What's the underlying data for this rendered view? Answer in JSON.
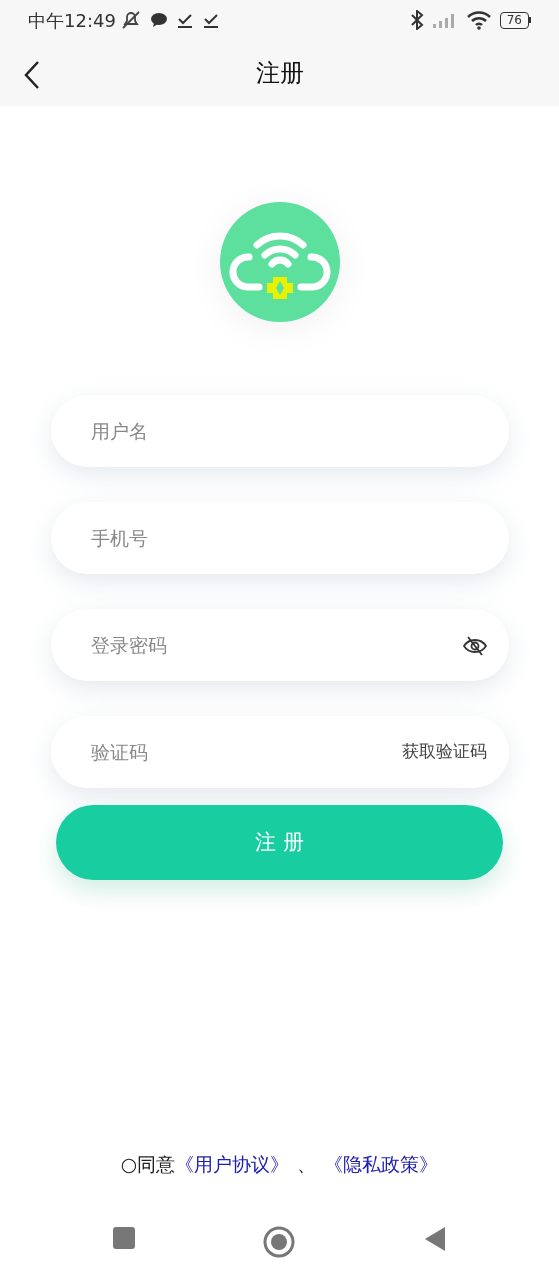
{
  "status_bar": {
    "time": "中午12:49",
    "battery": "76"
  },
  "header": {
    "title": "注册"
  },
  "fields": [
    {
      "kind": "text",
      "placeholder": "用户名"
    },
    {
      "kind": "text",
      "placeholder": "手机号"
    },
    {
      "kind": "password",
      "placeholder": "登录密码"
    },
    {
      "kind": "code",
      "placeholder": "验证码",
      "action": "获取验证码"
    }
  ],
  "submit": {
    "label": "注 册"
  },
  "agreement": {
    "prefix": "○同意",
    "links": [
      "《用户协议》",
      "《隐私政策》"
    ],
    "separator": "、"
  }
}
